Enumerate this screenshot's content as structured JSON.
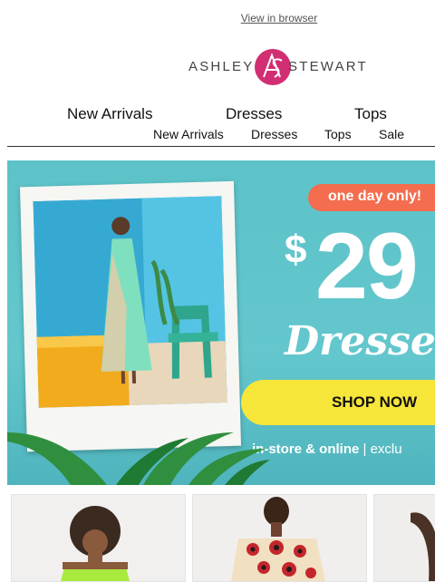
{
  "header": {
    "view_in_browser": "View in browser",
    "logo_left": "ASHLEY",
    "logo_right": "STEWART"
  },
  "nav_primary": [
    {
      "label": "New Arrivals"
    },
    {
      "label": "Dresses"
    },
    {
      "label": "Tops"
    }
  ],
  "nav_secondary": [
    {
      "label": "New Arrivals"
    },
    {
      "label": "Dresses"
    },
    {
      "label": "Tops"
    },
    {
      "label": "Sale"
    }
  ],
  "hero": {
    "badge": "one day only!",
    "price_currency": "$",
    "price_value": "29",
    "headline": "Dresses",
    "cta": "SHOP NOW",
    "channel_text": "in-store & online",
    "channel_separator": "|",
    "channel_suffix": "exclu"
  },
  "colors": {
    "hero_background": "#5dc3c9",
    "badge": "#f36d4e",
    "cta_button": "#f7e63a",
    "logo_accent": "#d12e73"
  },
  "products": [
    {
      "icon": "model-green-tube-dress"
    },
    {
      "icon": "model-red-print-dress"
    },
    {
      "icon": "model-partial"
    }
  ]
}
